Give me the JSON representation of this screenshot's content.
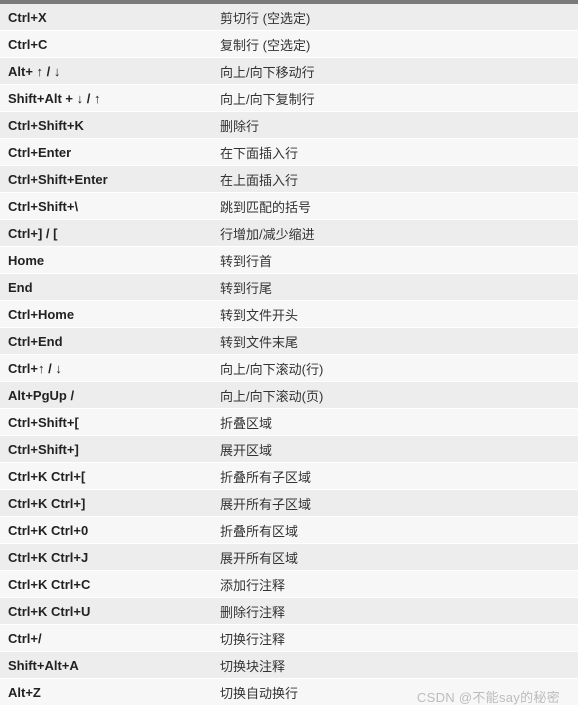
{
  "watermark": "CSDN @不能say的秘密",
  "rows": [
    {
      "shortcut": "Ctrl+X",
      "desc": "剪切行 (空选定)"
    },
    {
      "shortcut": "Ctrl+C",
      "desc": "复制行 (空选定)"
    },
    {
      "shortcut": "Alt+ ↑ / ↓",
      "desc": "向上/向下移动行"
    },
    {
      "shortcut": "Shift+Alt + ↓ / ↑",
      "desc": "向上/向下复制行"
    },
    {
      "shortcut": "Ctrl+Shift+K",
      "desc": "删除行"
    },
    {
      "shortcut": "Ctrl+Enter",
      "desc": "在下面插入行"
    },
    {
      "shortcut": "Ctrl+Shift+Enter",
      "desc": "在上面插入行"
    },
    {
      "shortcut": "Ctrl+Shift+\\",
      "desc": "跳到匹配的括号"
    },
    {
      "shortcut": "Ctrl+] / [",
      "desc": "行增加/减少缩进"
    },
    {
      "shortcut": "Home",
      "desc": "转到行首"
    },
    {
      "shortcut": "End",
      "desc": "转到行尾"
    },
    {
      "shortcut": "Ctrl+Home",
      "desc": "转到文件开头"
    },
    {
      "shortcut": "Ctrl+End",
      "desc": "转到文件末尾"
    },
    {
      "shortcut": "Ctrl+↑ / ↓",
      "desc": "向上/向下滚动(行)"
    },
    {
      "shortcut": "Alt+PgUp /",
      "desc": "向上/向下滚动(页)"
    },
    {
      "shortcut": "Ctrl+Shift+[",
      "desc": "折叠区域"
    },
    {
      "shortcut": "Ctrl+Shift+]",
      "desc": "展开区域"
    },
    {
      "shortcut": "Ctrl+K Ctrl+[",
      "desc": "折叠所有子区域"
    },
    {
      "shortcut": "Ctrl+K Ctrl+]",
      "desc": "展开所有子区域"
    },
    {
      "shortcut": "Ctrl+K Ctrl+0",
      "desc": "折叠所有区域"
    },
    {
      "shortcut": "Ctrl+K Ctrl+J",
      "desc": "展开所有区域"
    },
    {
      "shortcut": "Ctrl+K Ctrl+C",
      "desc": "添加行注释"
    },
    {
      "shortcut": "Ctrl+K Ctrl+U",
      "desc": "删除行注释"
    },
    {
      "shortcut": "Ctrl+/",
      "desc": "切换行注释"
    },
    {
      "shortcut": "Shift+Alt+A",
      "desc": "切换块注释"
    },
    {
      "shortcut": "Alt+Z",
      "desc": "切换自动换行"
    }
  ]
}
